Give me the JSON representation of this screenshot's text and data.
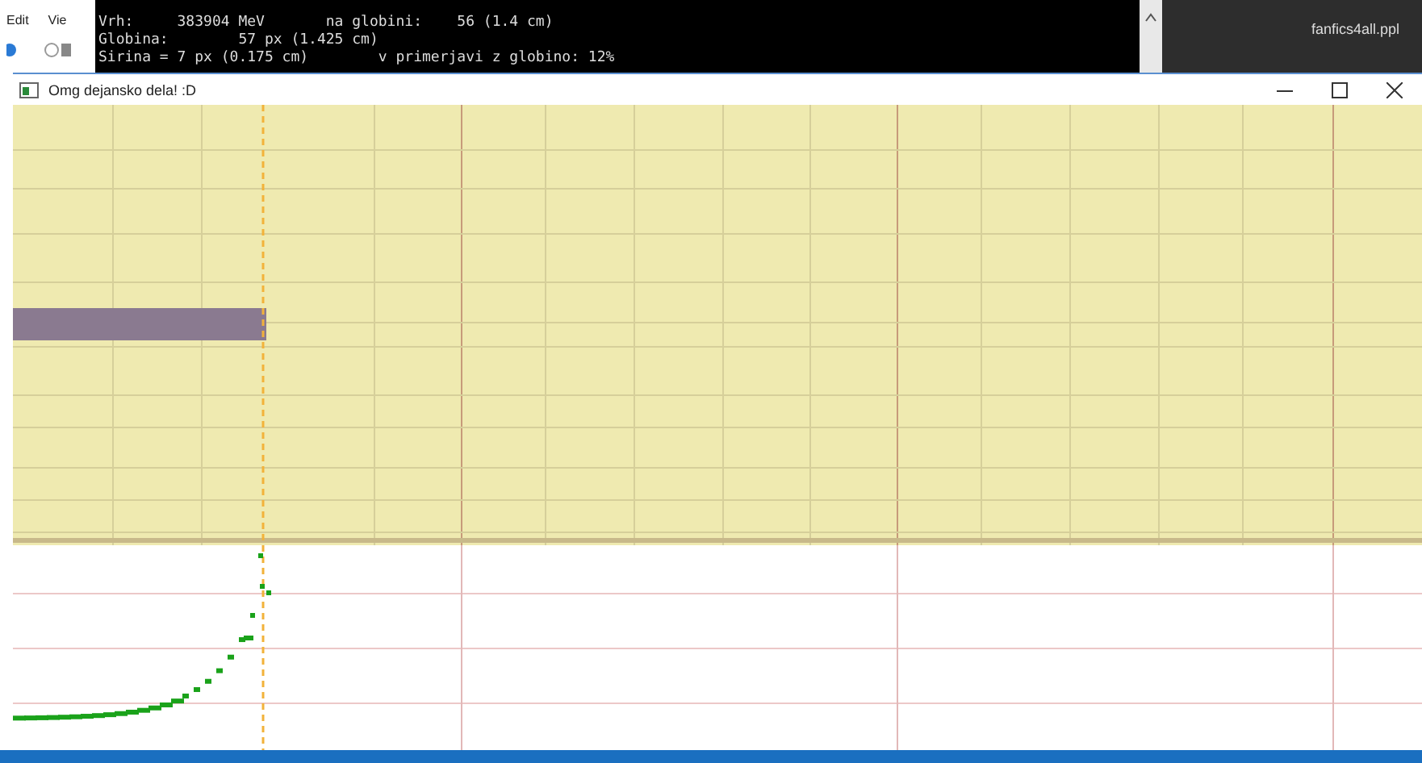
{
  "editor": {
    "menu": [
      "Edit",
      "Vie"
    ],
    "file_tab": "fanfics4all.ppl"
  },
  "console": {
    "lines": [
      "Vrh:     383904 MeV       na globini:    56 (1.4 cm)",
      "Globina:        57 px (1.425 cm)",
      "Sirina = 7 px (0.175 cm)        v primerjavi z globino: 12%"
    ]
  },
  "window": {
    "title": "Omg dejansko dela! :D"
  }
}
